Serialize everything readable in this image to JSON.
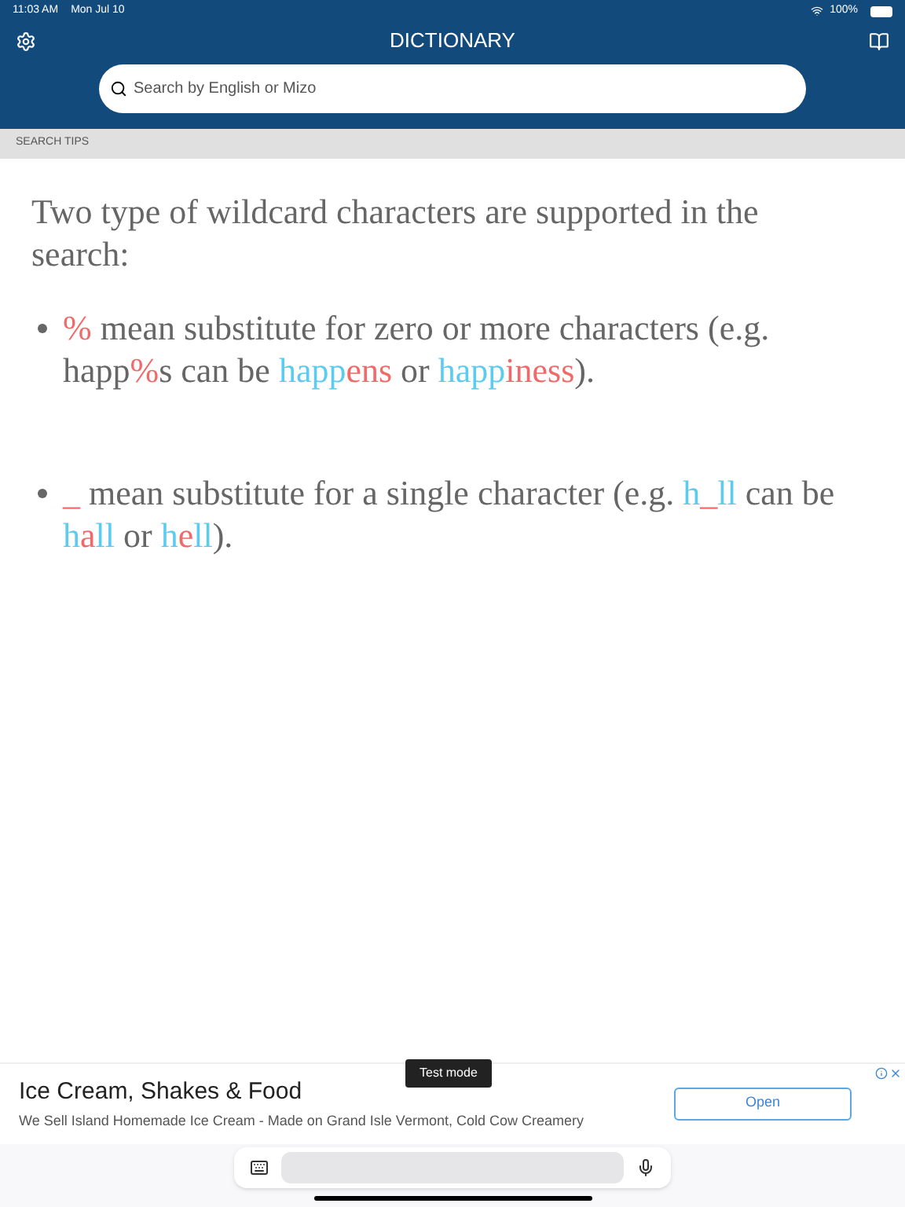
{
  "status_bar": {
    "time": "11:03 AM",
    "date": "Mon Jul 10",
    "battery": "100%"
  },
  "header": {
    "title": "DICTIONARY"
  },
  "search": {
    "placeholder": "Search by English or Mizo"
  },
  "section": {
    "title": "SEARCH TIPS"
  },
  "intro": "Two type of wildcard characters are supported in the search:",
  "tips": [
    {
      "segments": [
        {
          "text": "%",
          "color": "#f06a6a"
        },
        {
          "text": " mean substitute for zero or more characters (e.g. happ",
          "color": "#666666"
        },
        {
          "text": "%",
          "color": "#f06a6a"
        },
        {
          "text": "s can be ",
          "color": "#666666"
        },
        {
          "text": "happ",
          "color": "#5ccbf0"
        },
        {
          "text": "ens",
          "color": "#f06a6a"
        },
        {
          "text": " or ",
          "color": "#666666"
        },
        {
          "text": "happ",
          "color": "#5ccbf0"
        },
        {
          "text": "iness",
          "color": "#f06a6a"
        },
        {
          "text": ").",
          "color": "#666666"
        }
      ]
    },
    {
      "segments": [
        {
          "text": "_",
          "color": "#f06a6a"
        },
        {
          "text": " mean substitute for a single character (e.g. ",
          "color": "#666666"
        },
        {
          "text": "h",
          "color": "#5ccbf0"
        },
        {
          "text": "_",
          "color": "#f06a6a"
        },
        {
          "text": "ll",
          "color": "#5ccbf0"
        },
        {
          "text": " can be ",
          "color": "#666666"
        },
        {
          "text": "h",
          "color": "#5ccbf0"
        },
        {
          "text": "a",
          "color": "#f06a6a"
        },
        {
          "text": "ll",
          "color": "#5ccbf0"
        },
        {
          "text": " or ",
          "color": "#666666"
        },
        {
          "text": "h",
          "color": "#5ccbf0"
        },
        {
          "text": "e",
          "color": "#f06a6a"
        },
        {
          "text": "ll",
          "color": "#5ccbf0"
        },
        {
          "text": ").",
          "color": "#666666"
        }
      ]
    }
  ],
  "ad": {
    "title": "Ice Cream, Shakes & Food",
    "description": "We Sell Island Homemade Ice Cream - Made on Grand Isle Vermont, Cold Cow Creamery",
    "badge": "Test mode",
    "button": "Open"
  }
}
